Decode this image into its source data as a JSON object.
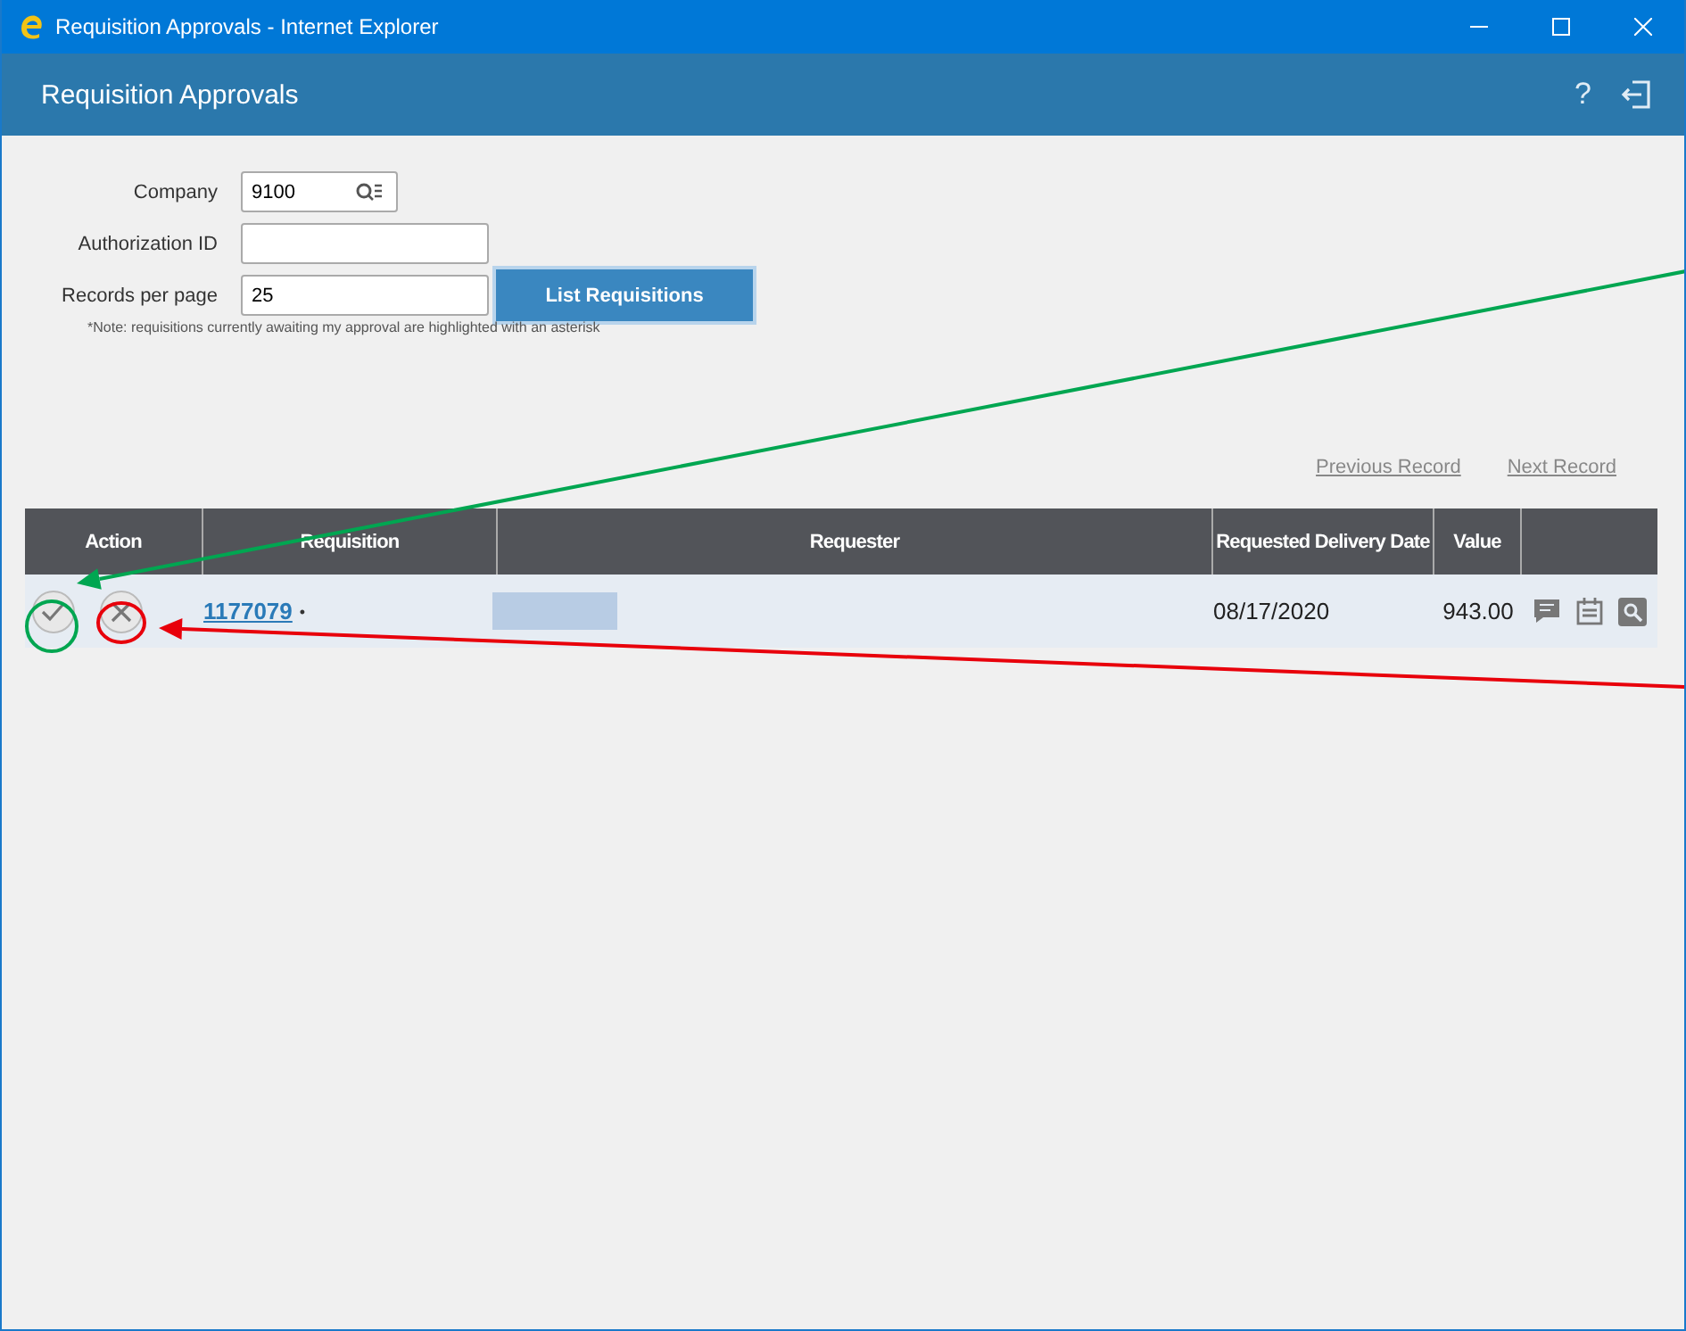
{
  "window": {
    "title": "Requisition Approvals - Internet Explorer"
  },
  "app_header": {
    "title": "Requisition Approvals",
    "help": "?"
  },
  "form": {
    "fields": [
      {
        "label": "Company",
        "value": "9100",
        "kind": "lookup"
      },
      {
        "label": "Authorization ID",
        "kind": "text"
      },
      {
        "label": "Records per page",
        "value": "25",
        "kind": "text"
      }
    ],
    "button": "List Requisitions",
    "note": "*Note: requisitions currently awaiting my approval are highlighted with an asterisk"
  },
  "pager": [
    "Previous Record",
    "Next Record"
  ],
  "table": {
    "columns": [
      "Action",
      "Requisition",
      "Requester",
      "Requested Delivery Date",
      "Value"
    ],
    "rows": [
      {
        "requisition": "1177079",
        "marker": "•",
        "requester_redacted": true,
        "date": "08/17/2020",
        "value": "943.00"
      }
    ]
  },
  "annotations": [
    {
      "color": "#00a651"
    },
    {
      "color": "#e8000b"
    }
  ]
}
